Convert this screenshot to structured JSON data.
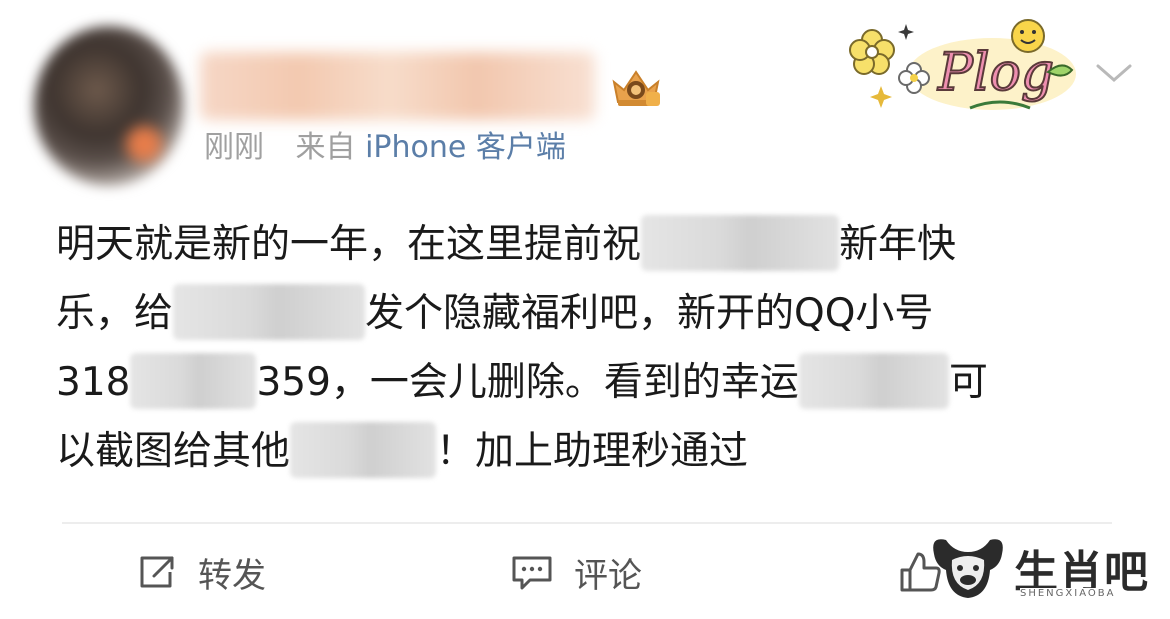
{
  "post": {
    "time": "刚刚",
    "source_prefix": "来自",
    "source_device": "iPhone 客户端",
    "sticker_text": "Plog",
    "body": {
      "line1_a": "明天就是新的一年，在这里提前祝",
      "line1_b": "新年快",
      "line2_a": "乐，给",
      "line2_b": "发个隐藏福利吧，新开的QQ小号",
      "line3_a": "318",
      "line3_b": "359，一会儿删除。看到的幸运",
      "line3_c": "可",
      "line4_a": "以截图给其他",
      "line4_b": "！加上助理秒通过"
    }
  },
  "actions": {
    "repost_label": "转发",
    "comment_label": "评论"
  },
  "watermark": {
    "brand": "生肖吧",
    "sub": "SHENGXIAOBA"
  },
  "colors": {
    "meta_gray": "#a0a0a0",
    "device_blue": "#5b7ea8",
    "action_gray": "#555555"
  },
  "icons": [
    "chevron-down-icon",
    "crown-badge-icon",
    "repost-icon",
    "comment-icon",
    "like-icon"
  ]
}
